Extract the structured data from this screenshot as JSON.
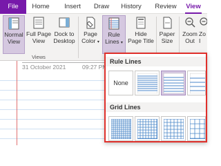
{
  "tabs": {
    "file": "File",
    "home": "Home",
    "insert": "Insert",
    "draw": "Draw",
    "history": "History",
    "review": "Review",
    "view": "View"
  },
  "ribbon": {
    "normal_view": [
      "Normal",
      "View"
    ],
    "full_page_view": [
      "Full Page",
      "View"
    ],
    "dock_to_desktop": [
      "Dock to",
      "Desktop"
    ],
    "page_color": [
      "Page",
      "Color"
    ],
    "rule_lines": [
      "Rule",
      "Lines"
    ],
    "hide_page_title": [
      "Hide",
      "Page Title"
    ],
    "paper_size": [
      "Paper",
      "Size"
    ],
    "zoom_out": [
      "Zoom",
      "Out"
    ],
    "zoom_in": [
      "Zo",
      "I"
    ],
    "views_group": "Views"
  },
  "page": {
    "date": "31 October 2021",
    "time": "09:27 PM"
  },
  "dropdown": {
    "rule_lines_header": "Rule Lines",
    "none_label": "None",
    "grid_lines_header": "Grid Lines"
  },
  "colors": {
    "accent": "#7719aa",
    "rule_line": "#4a86c8",
    "margin_line": "#e07070",
    "highlight": "#e0302b"
  }
}
